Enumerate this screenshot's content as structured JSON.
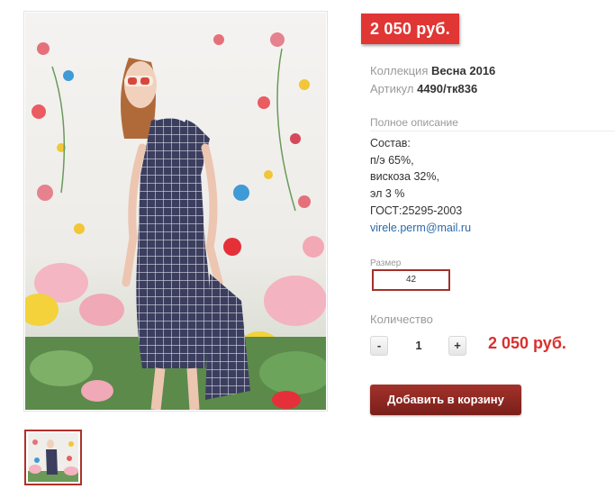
{
  "product": {
    "price_badge": "2 050 руб.",
    "collection_label": "Коллекция",
    "collection_value": "Весна 2016",
    "article_label": "Артикул",
    "article_value": "4490/тк836",
    "description_title": "Полное описание",
    "description_lines": [
      "Состав:",
      "п/э 65%,",
      "вискоза 32%,",
      "эл 3 %",
      "ГОСТ:25295-2003"
    ],
    "email": "virele.perm@mail.ru"
  },
  "size": {
    "label": "Размер",
    "selected": "42"
  },
  "quantity": {
    "label": "Количество",
    "minus": "-",
    "value": "1",
    "plus": "+"
  },
  "total_price": "2 050 руб.",
  "add_to_cart": "Добавить в корзину",
  "colors": {
    "price_badge_bg": "#e03634",
    "accent_red": "#d8302e",
    "button_bg": "#8f2a24",
    "link": "#2a6aa8"
  }
}
